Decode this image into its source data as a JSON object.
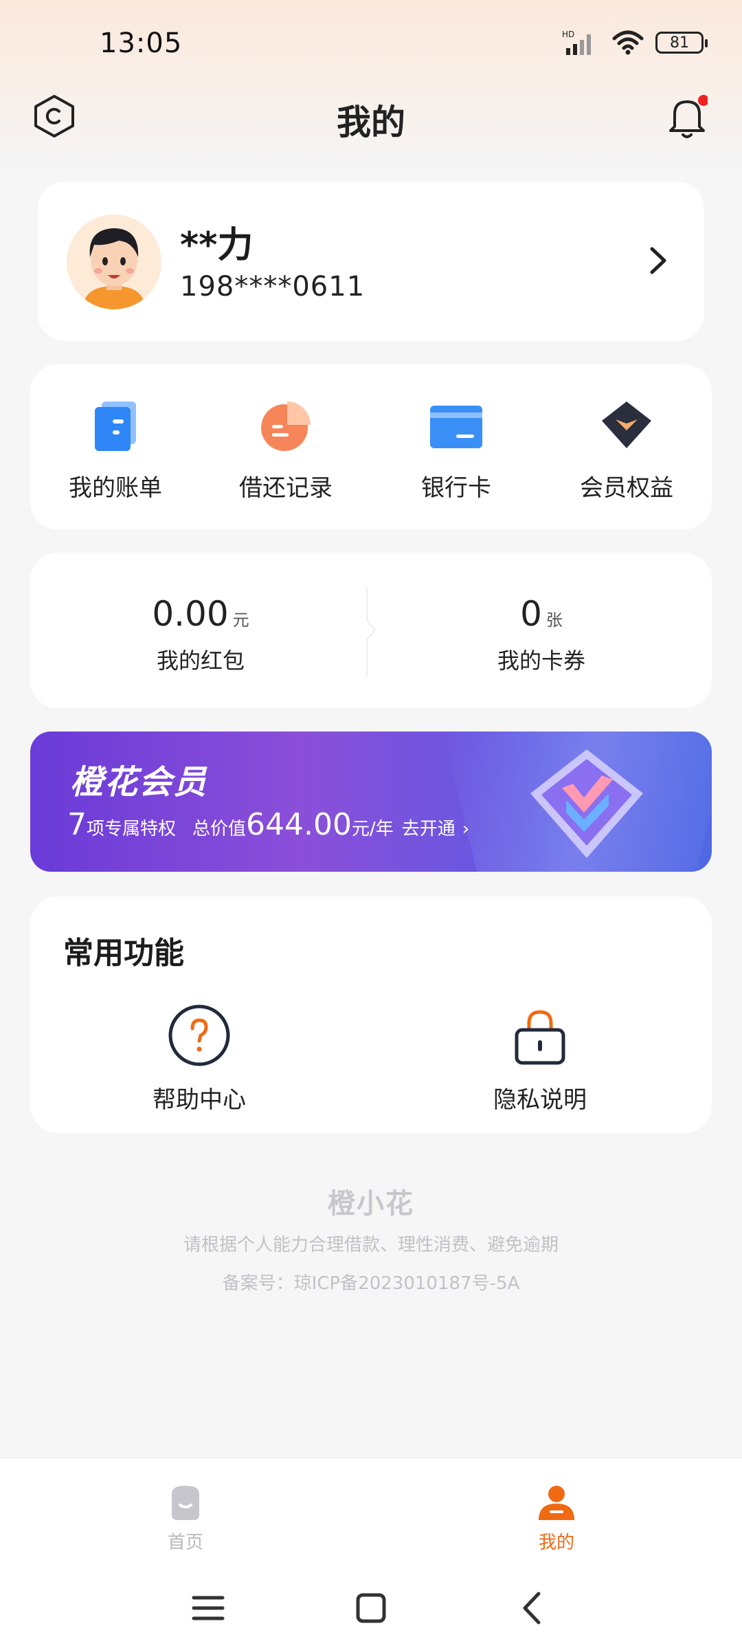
{
  "status_bar": {
    "time": "13:05",
    "network_label": "HD",
    "battery": "81"
  },
  "header": {
    "title": "我的"
  },
  "profile": {
    "name": "**力",
    "phone": "198****0611"
  },
  "quick_actions": [
    {
      "label": "我的账单",
      "icon": "bill-icon"
    },
    {
      "label": "借还记录",
      "icon": "pie-chart-icon"
    },
    {
      "label": "银行卡",
      "icon": "bank-card-icon"
    },
    {
      "label": "会员权益",
      "icon": "member-badge-icon"
    }
  ],
  "wallet": {
    "red_packet": {
      "value": "0.00",
      "unit": "元",
      "label": "我的红包"
    },
    "coupons": {
      "value": "0",
      "unit": "张",
      "label": "我的卡券"
    }
  },
  "vip": {
    "title": "橙花会员",
    "count": "7",
    "count_text": "项专属特权",
    "total_label": "总价值",
    "price": "644.00",
    "price_unit": "元/年",
    "cta": "去开通",
    "cta_arrow": "›"
  },
  "common_functions": {
    "title": "常用功能",
    "items": [
      {
        "label": "帮助中心",
        "icon": "help-icon"
      },
      {
        "label": "隐私说明",
        "icon": "lock-icon"
      }
    ]
  },
  "footer": {
    "brand": "橙小花",
    "tip": "请根据个人能力合理借款、理性消费、避免逾期",
    "icp": "备案号：琼ICP备2023010187号-5A"
  },
  "tabbar": {
    "tabs": [
      {
        "label": "首页",
        "active": false
      },
      {
        "label": "我的",
        "active": true
      }
    ]
  },
  "colors": {
    "accent": "#f06a13",
    "inactive": "#b7b7bd",
    "text": "#222222",
    "vip_start": "#6a3bd8",
    "vip_end": "#4f69e4"
  }
}
